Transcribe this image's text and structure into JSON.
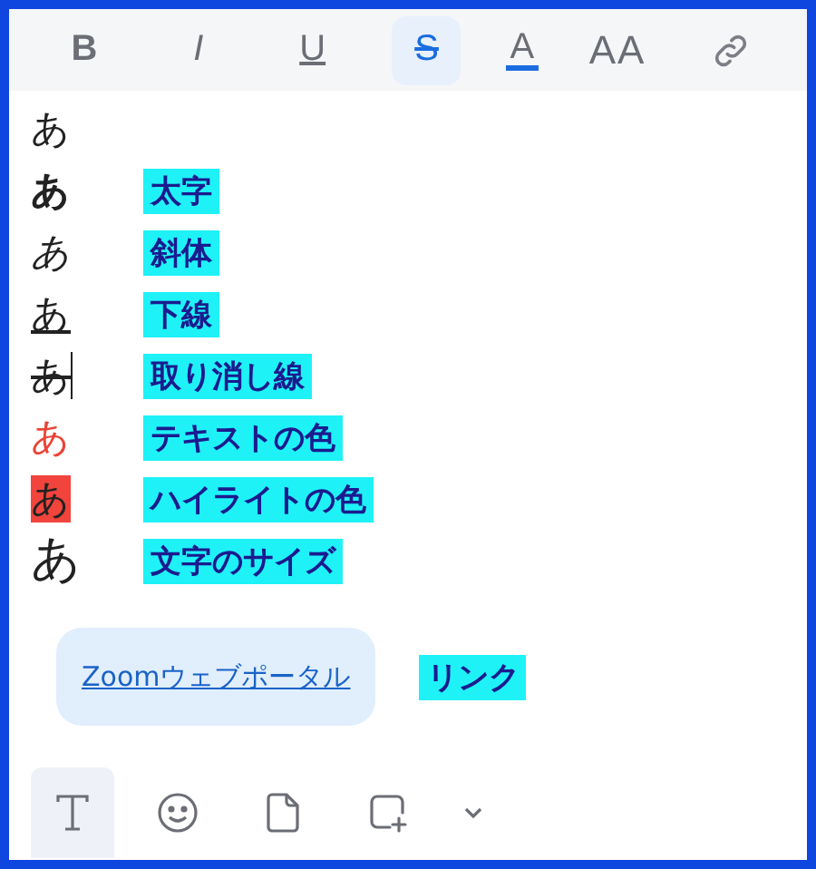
{
  "format_toolbar": [
    {
      "kind": "bold",
      "label": "B",
      "selected": false
    },
    {
      "kind": "italic",
      "label": "I",
      "selected": false
    },
    {
      "kind": "underline",
      "label": "U",
      "selected": false
    },
    {
      "kind": "strike",
      "label": "S",
      "selected": true
    },
    {
      "kind": "color",
      "label": "A",
      "selected": false
    },
    {
      "kind": "size",
      "label": "AA",
      "selected": false
    },
    {
      "kind": "link",
      "selected": false
    }
  ],
  "samples": [
    {
      "kind": "plain",
      "text": "あ",
      "caret": false
    },
    {
      "kind": "bold",
      "text": "あ",
      "caret": false,
      "annotation": "太字"
    },
    {
      "kind": "italic",
      "text": "あ",
      "caret": false,
      "annotation": "斜体"
    },
    {
      "kind": "underline",
      "text": "あ",
      "caret": false,
      "annotation": "下線"
    },
    {
      "kind": "strike",
      "text": "あ",
      "caret": true,
      "annotation": "取り消し線"
    },
    {
      "kind": "color",
      "text": "あ",
      "caret": false,
      "color": "#ea4335",
      "annotation": "テキストの色"
    },
    {
      "kind": "highlight",
      "text": "あ",
      "caret": false,
      "color": "#f0443c",
      "annotation": "ハイライトの色"
    },
    {
      "kind": "size",
      "text": "あ",
      "caret": false,
      "annotation": "文字のサイズ"
    }
  ],
  "link": {
    "text": "Zoomウェブポータル",
    "annotation": "リンク"
  },
  "bottom_toolbar": [
    {
      "kind": "text",
      "selected": true
    },
    {
      "kind": "emoji",
      "selected": false
    },
    {
      "kind": "file",
      "selected": false
    },
    {
      "kind": "screenshot",
      "selected": false
    },
    {
      "kind": "more",
      "selected": false
    }
  ]
}
